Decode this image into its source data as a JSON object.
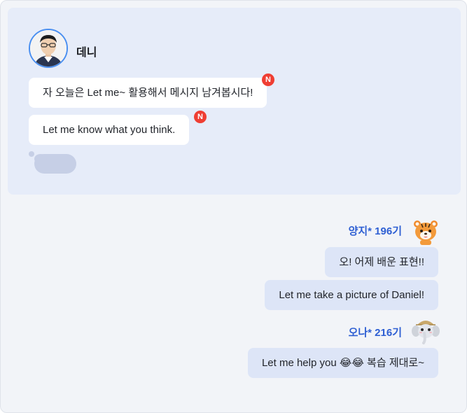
{
  "host": {
    "name": "데니",
    "messages": [
      {
        "text": "자 오늘은 Let me~ 활용해서 메시지 남겨봅시다!",
        "badge": "N"
      },
      {
        "text": "Let me know what you think.",
        "badge": "N"
      }
    ]
  },
  "replies": [
    {
      "name": "양지* 196기",
      "avatar": "tiger-avatar-icon",
      "messages": [
        "오! 어제 배운 표현!!",
        "Let me take a picture of Daniel!"
      ]
    },
    {
      "name": "오나* 216기",
      "avatar": "elephant-avatar-icon",
      "messages": [
        "Let me help you 😂😂 복습 제대로~"
      ]
    }
  ]
}
